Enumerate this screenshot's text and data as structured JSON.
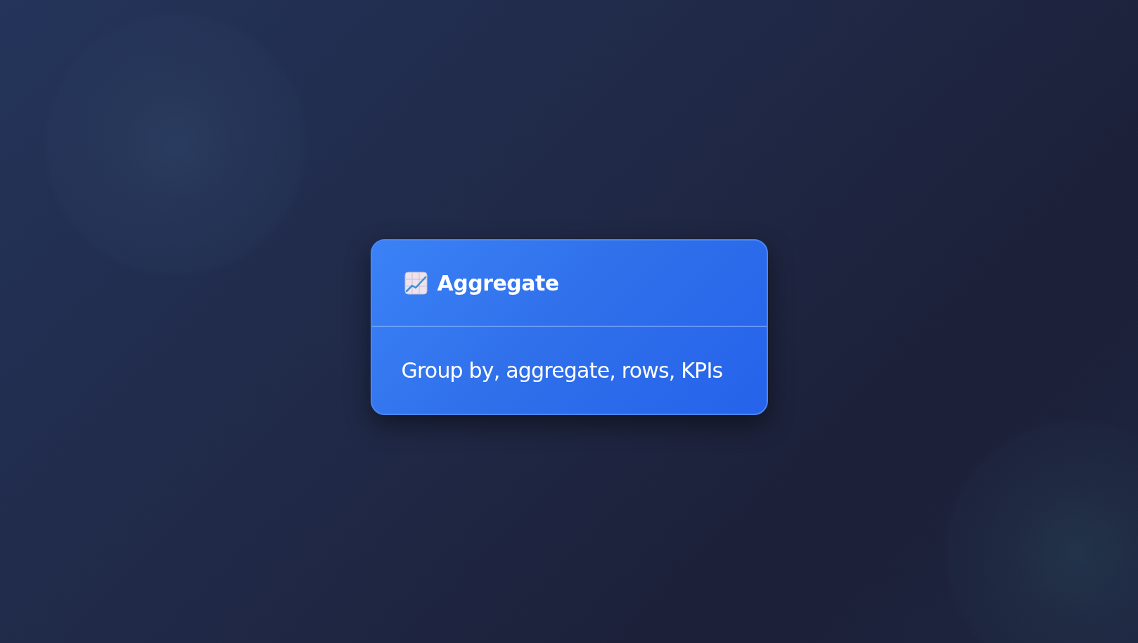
{
  "card": {
    "title": "Aggregate",
    "description": "Group by, aggregate, rows, KPIs"
  }
}
